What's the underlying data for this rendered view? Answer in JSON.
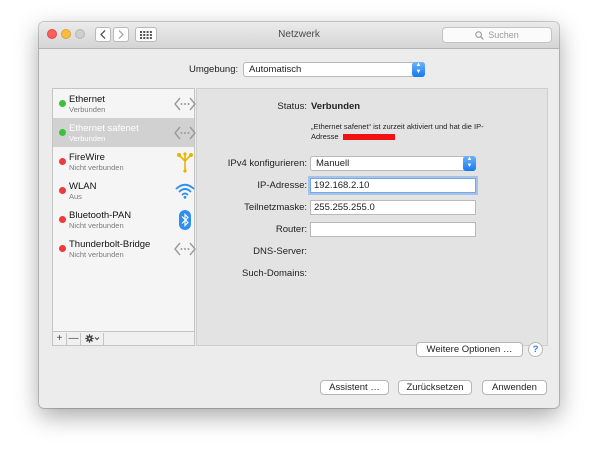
{
  "window": {
    "title": "Netzwerk"
  },
  "toolbar": {
    "search_placeholder": "Suchen"
  },
  "umgebung": {
    "label": "Umgebung:",
    "value": "Automatisch"
  },
  "services": [
    {
      "name": "Ethernet",
      "status": "Verbunden",
      "state": "green",
      "icon": "ethernet-icon",
      "selected": false
    },
    {
      "name": "Ethernet safenet",
      "status": "Verbunden",
      "state": "green",
      "icon": "ethernet-icon",
      "selected": true
    },
    {
      "name": "FireWire",
      "status": "Nicht verbunden",
      "state": "red",
      "icon": "firewire-icon",
      "selected": false
    },
    {
      "name": "WLAN",
      "status": "Aus",
      "state": "red",
      "icon": "wifi-icon",
      "selected": false
    },
    {
      "name": "Bluetooth-PAN",
      "status": "Nicht verbunden",
      "state": "red",
      "icon": "bluetooth-icon",
      "selected": false
    },
    {
      "name": "Thunderbolt-Bridge",
      "status": "Nicht verbunden",
      "state": "red",
      "icon": "ethernet-icon",
      "selected": false
    }
  ],
  "sidebar_buttons": {
    "add": "+",
    "remove": "—"
  },
  "detail": {
    "status_label": "Status:",
    "status_value": "Verbunden",
    "status_description_line1": "„Ethernet safenet“ ist zurzeit aktiviert und hat die IP-",
    "status_description_line2": "Adresse",
    "ipv4_label": "IPv4 konfigurieren:",
    "ipv4_value": "Manuell",
    "ip_label": "IP-Adresse:",
    "ip_value": "192.168.2.10",
    "subnet_label": "Teilnetzmaske:",
    "subnet_value": "255.255.255.0",
    "router_label": "Router:",
    "router_value": "",
    "dns_label": "DNS-Server:",
    "search_domains_label": "Such-Domains:",
    "advanced_button": "Weitere Optionen …",
    "help": "?"
  },
  "footer": {
    "assistant_button": "Assistent …",
    "reset_button": "Zurücksetzen",
    "apply_button": "Anwenden"
  },
  "colors": {
    "accent": "#1778f2",
    "connected": "#3cc13b",
    "disconnected": "#ee3a3a",
    "redaction": "#f01212"
  }
}
